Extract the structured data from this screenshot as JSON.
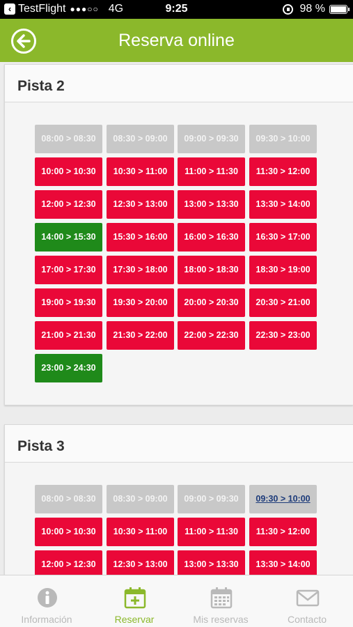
{
  "status_bar": {
    "carrier": "TestFlight",
    "signal": "●●●○○",
    "network": "4G",
    "time": "9:25",
    "battery": "98 %"
  },
  "header": {
    "title": "Reserva online",
    "back_icon": "arrow-left-circle-icon"
  },
  "courts": [
    {
      "name": "Pista 2",
      "slots": [
        {
          "label": "08:00 > 08:30",
          "status": "unavailable"
        },
        {
          "label": "08:30 > 09:00",
          "status": "unavailable"
        },
        {
          "label": "09:00 > 09:30",
          "status": "unavailable"
        },
        {
          "label": "09:30 > 10:00",
          "status": "unavailable"
        },
        {
          "label": "10:00 > 10:30",
          "status": "occupied"
        },
        {
          "label": "10:30 > 11:00",
          "status": "occupied"
        },
        {
          "label": "11:00 > 11:30",
          "status": "occupied"
        },
        {
          "label": "11:30 > 12:00",
          "status": "occupied"
        },
        {
          "label": "12:00 > 12:30",
          "status": "occupied"
        },
        {
          "label": "12:30 > 13:00",
          "status": "occupied"
        },
        {
          "label": "13:00 > 13:30",
          "status": "occupied"
        },
        {
          "label": "13:30 > 14:00",
          "status": "occupied"
        },
        {
          "label": "14:00 > 15:30",
          "status": "available"
        },
        {
          "label": "15:30 > 16:00",
          "status": "occupied"
        },
        {
          "label": "16:00 > 16:30",
          "status": "occupied"
        },
        {
          "label": "16:30 > 17:00",
          "status": "occupied"
        },
        {
          "label": "17:00 > 17:30",
          "status": "occupied"
        },
        {
          "label": "17:30 > 18:00",
          "status": "occupied"
        },
        {
          "label": "18:00 > 18:30",
          "status": "occupied"
        },
        {
          "label": "18:30 > 19:00",
          "status": "occupied"
        },
        {
          "label": "19:00 > 19:30",
          "status": "occupied"
        },
        {
          "label": "19:30 > 20:00",
          "status": "occupied"
        },
        {
          "label": "20:00 > 20:30",
          "status": "occupied"
        },
        {
          "label": "20:30 > 21:00",
          "status": "occupied"
        },
        {
          "label": "21:00 > 21:30",
          "status": "occupied"
        },
        {
          "label": "21:30 > 22:00",
          "status": "occupied"
        },
        {
          "label": "22:00 > 22:30",
          "status": "occupied"
        },
        {
          "label": "22:30 > 23:00",
          "status": "occupied"
        },
        {
          "label": "23:00 > 24:30",
          "status": "available"
        }
      ]
    },
    {
      "name": "Pista 3",
      "slots": [
        {
          "label": "08:00 > 08:30",
          "status": "unavailable"
        },
        {
          "label": "08:30 > 09:00",
          "status": "unavailable"
        },
        {
          "label": "09:00 > 09:30",
          "status": "unavailable"
        },
        {
          "label": "09:30 > 10:00",
          "status": "selected"
        },
        {
          "label": "10:00 > 10:30",
          "status": "occupied"
        },
        {
          "label": "10:30 > 11:00",
          "status": "occupied"
        },
        {
          "label": "11:00 > 11:30",
          "status": "occupied"
        },
        {
          "label": "11:30 > 12:00",
          "status": "occupied"
        },
        {
          "label": "12:00 > 12:30",
          "status": "occupied"
        },
        {
          "label": "12:30 > 13:00",
          "status": "occupied"
        },
        {
          "label": "13:00 > 13:30",
          "status": "occupied"
        },
        {
          "label": "13:30 > 14:00",
          "status": "occupied"
        }
      ]
    }
  ],
  "tabs": [
    {
      "label": "Información",
      "icon": "info-icon",
      "active": false
    },
    {
      "label": "Reservar",
      "icon": "calendar-add-icon",
      "active": true
    },
    {
      "label": "Mis reservas",
      "icon": "calendar-icon",
      "active": false
    },
    {
      "label": "Contacto",
      "icon": "envelope-icon",
      "active": false
    }
  ],
  "colors": {
    "brand_green": "#8bb82b",
    "occupied_red": "#ea0838",
    "available_green": "#1f8a1a",
    "unavailable_gray": "#c8c8c8",
    "tab_inactive": "#b9b9b9"
  }
}
